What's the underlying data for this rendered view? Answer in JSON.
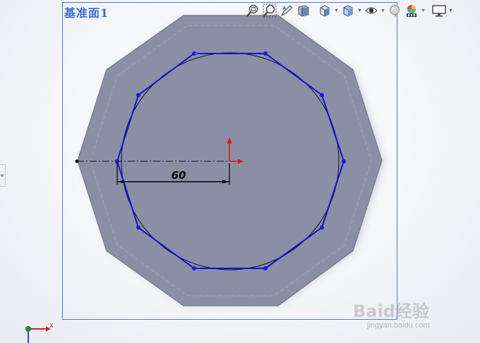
{
  "plane": {
    "name": "基准面1"
  },
  "sketch": {
    "dimension_label": "60"
  },
  "toolbar": {
    "buttons": [
      {
        "icon": "zoom-to-fit-icon"
      },
      {
        "icon": "zoom-to-area-icon"
      },
      {
        "icon": "previous-view-icon"
      },
      {
        "icon": "section-view-icon"
      },
      {
        "icon": "view-orientation-icon"
      },
      {
        "icon": "display-style-icon"
      },
      {
        "icon": "hide-show-items-icon"
      },
      {
        "icon": "edit-appearance-icon"
      },
      {
        "icon": "apply-scene-icon"
      },
      {
        "icon": "view-settings-icon"
      }
    ]
  },
  "triad": {
    "x_label": "X"
  },
  "watermark": {
    "brand": "Baid经验",
    "url": "jingyan.baidu.com"
  },
  "colors": {
    "plane_border": "#4c7bd8",
    "plane_label": "#3c6fd7",
    "part_fill": "#8a8fa6",
    "polygon_blue": "#1212d6",
    "dimension": "#000000",
    "origin_red": "#e0141c"
  }
}
